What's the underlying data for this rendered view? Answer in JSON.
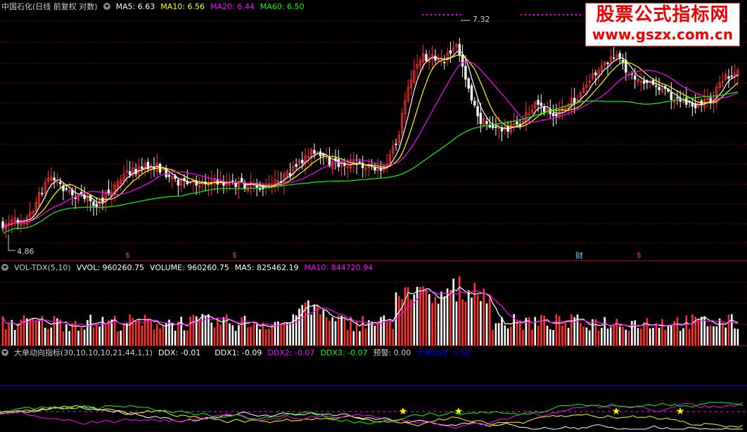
{
  "main_panel": {
    "stock_name": "中国石化(日线 前复权 对数)",
    "ma5": "MA5: 6.63",
    "ma10": "MA10: 6.56",
    "ma20": "MA20: 6.44",
    "ma60": "MA60: 6.50",
    "high_label": "7.32",
    "low_label": "4.86",
    "event_marks": [
      "$",
      "$",
      "财",
      "$"
    ]
  },
  "volume_panel": {
    "indicator": "VOL-TDX(5,10)",
    "vvol": "VVOL: 960260.75",
    "volume": "VOLUME: 960260.75",
    "ma5": "MA5: 825462.19",
    "ma10": "MA10: 844720.94"
  },
  "ddx_panel": {
    "indicator": "大单动向指标(30,10,10,10,21,44,1,1)",
    "ddx": "DDX: -0.01",
    "ddx1": "DDX1: -0.09",
    "ddx2": "DDX2: -0.07",
    "ddx3": "DDX3: -0.07",
    "warning": "预警: 0.00",
    "trend_label": "大单动向",
    "trend_value": "0.50"
  },
  "watermark": {
    "line1": "股票公式指标网",
    "line2": "www.gszx.com.cn"
  },
  "colors": {
    "up": "#ff3232",
    "down": "#ffffff",
    "ma5": "#ffffff",
    "ma10": "#ffff00",
    "ma20": "#ff00ff",
    "ma60": "#00ff00",
    "grid": "#8b0000",
    "ddx_blue": "#0000ff"
  }
}
